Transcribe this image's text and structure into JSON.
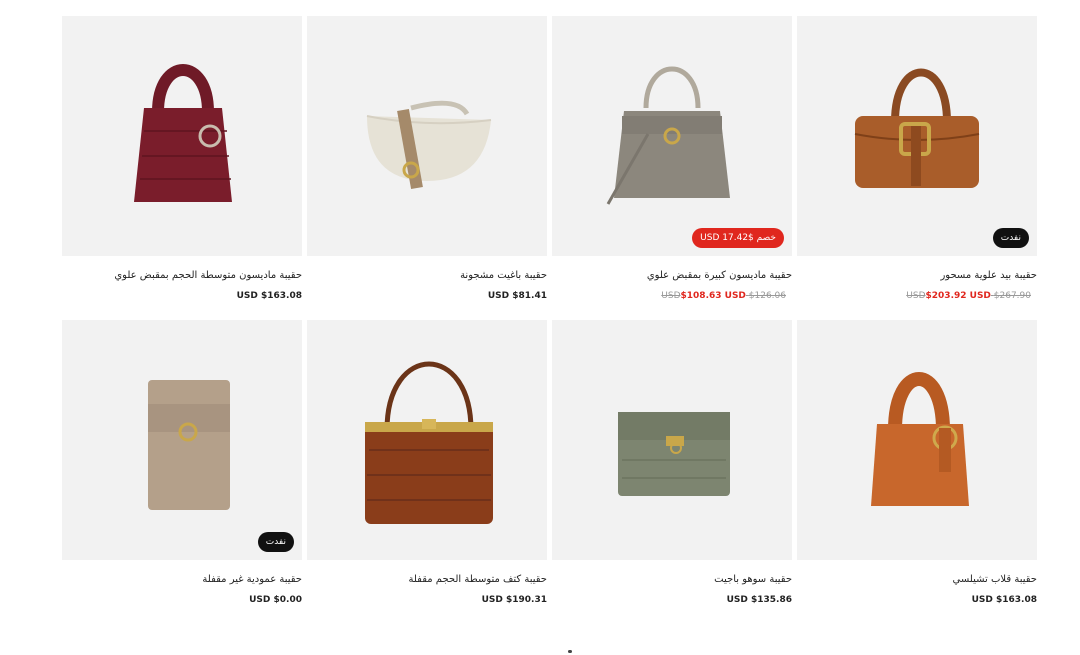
{
  "products": [
    {
      "name": "حقيبة بيد علوية مسحور",
      "old_price": "$267.90 USD",
      "price": "$203.92 USD",
      "badge": "نفدت",
      "badge_type": "sold",
      "icon": "handbag-brown-icon"
    },
    {
      "name": "حقيبة ماديسون كبيرة بمقبض علوي",
      "old_price": "$126.06 USD",
      "price": "$108.63 USD",
      "badge": "خصم $17.42 USD",
      "badge_type": "sale",
      "icon": "handbag-taupe-icon"
    },
    {
      "name": "حقيبة باغيت مشجونة",
      "old_price": "",
      "price": "$81.41 USD",
      "badge": "",
      "badge_type": "",
      "icon": "baguette-bag-icon"
    },
    {
      "name": "حقيبة ماديسون متوسطة الحجم بمقبض علوي",
      "old_price": "",
      "price": "$163.08 USD",
      "badge": "",
      "badge_type": "",
      "icon": "handbag-burgundy-icon"
    },
    {
      "name": "حقيبة قلاب تشيلسي",
      "old_price": "",
      "price": "$163.08 USD",
      "badge": "",
      "badge_type": "",
      "icon": "handbag-orange-icon"
    },
    {
      "name": "حقيبة سوهو باجيت",
      "old_price": "",
      "price": "$135.86 USD",
      "badge": "",
      "badge_type": "",
      "icon": "clutch-olive-icon"
    },
    {
      "name": "حقيبة كتف متوسطة الحجم مقفلة",
      "old_price": "",
      "price": "$190.31 USD",
      "badge": "",
      "badge_type": "",
      "icon": "frame-bag-croc-icon"
    },
    {
      "name": "حقيبة عمودية غير مقفلة",
      "old_price": "",
      "price": "$0.00 USD",
      "badge": "نفدت",
      "badge_type": "sold",
      "icon": "chain-bag-icon"
    }
  ],
  "colors": {
    "sale": "#e0271e",
    "sold_badge": "#111111",
    "tile_bg": "#f2f2f2"
  }
}
